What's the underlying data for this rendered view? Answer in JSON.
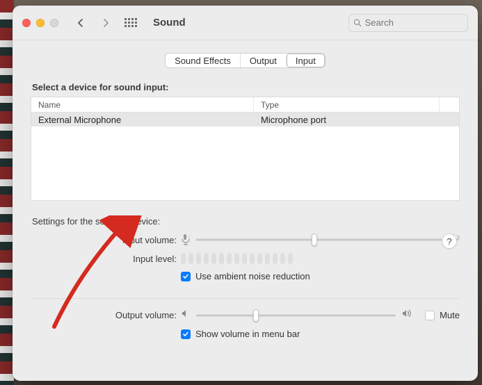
{
  "header": {
    "title": "Sound",
    "search_placeholder": "Search"
  },
  "tabs": [
    {
      "label": "Sound Effects",
      "active": false
    },
    {
      "label": "Output",
      "active": false
    },
    {
      "label": "Input",
      "active": true
    }
  ],
  "input_section": {
    "heading": "Select a device for sound input:",
    "columns": {
      "name": "Name",
      "type": "Type"
    },
    "devices": [
      {
        "name": "External Microphone",
        "type": "Microphone port"
      }
    ]
  },
  "device_settings": {
    "heading": "Settings for the selected device:",
    "input_volume_label": "Input volume:",
    "input_volume_percent": 48,
    "input_level_label": "Input level:",
    "input_level_segments": 15,
    "noise_reduction_label": "Use ambient noise reduction",
    "noise_reduction_checked": true
  },
  "output": {
    "output_volume_label": "Output volume:",
    "output_volume_percent": 30,
    "mute_label": "Mute",
    "mute_checked": false,
    "show_in_menu_label": "Show volume in menu bar",
    "show_in_menu_checked": true
  },
  "help_label": "?"
}
